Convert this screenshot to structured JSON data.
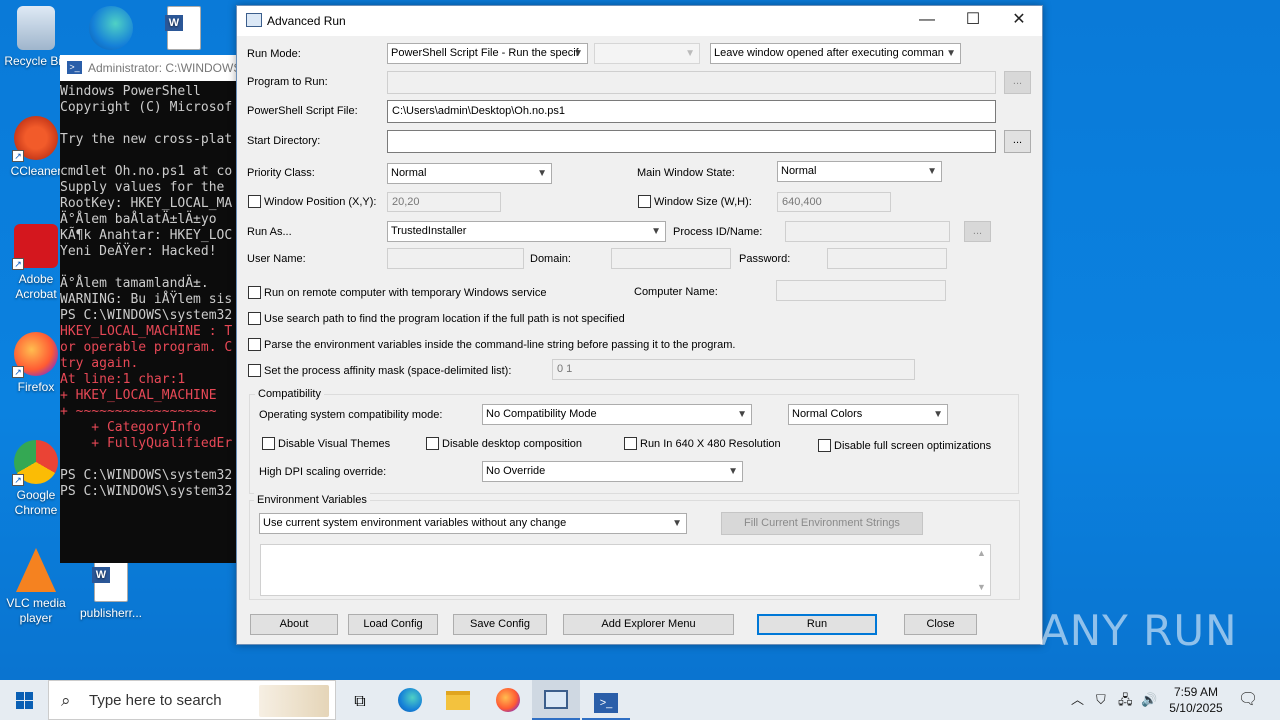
{
  "desktop": {
    "icons": [
      {
        "label": "Recycle Bin"
      },
      {
        "label": "CCleaner"
      },
      {
        "label": "Adobe Acrobat"
      },
      {
        "label": "Firefox"
      },
      {
        "label": "Google Chrome"
      },
      {
        "label": "VLC media player"
      },
      {
        "label": "publisherr..."
      }
    ]
  },
  "powershell": {
    "title": "Administrator: C:\\WINDOWS",
    "lines": [
      "Windows PowerShell",
      "Copyright (C) Microsof",
      "",
      "Try the new cross-plat",
      "",
      "cmdlet Oh.no.ps1 at co",
      "Supply values for the",
      "RootKey: HKEY_LOCAL_MA",
      "Ä°Å­lem baÅ­latÄ±lÄ±yo",
      "KÃ¶k Anahtar: HKEY_LOC",
      "Yeni DeÄŸer: Hacked!",
      "",
      "Ä°Å­lem tamamlandÄ±.",
      "WARNING: Bu iÅŸlem sis",
      "PS C:\\WINDOWS\\system32"
    ],
    "error_lines": [
      "HKEY_LOCAL_MACHINE : T",
      "or operable program. C",
      "try again.",
      "At line:1 char:1",
      "+ HKEY_LOCAL_MACHINE",
      "+ ~~~~~~~~~~~~~~~~~~",
      "    + CategoryInfo",
      "    + FullyQualifiedEr"
    ],
    "tail_lines": [
      "",
      "PS C:\\WINDOWS\\system32",
      "PS C:\\WINDOWS\\system32"
    ]
  },
  "dialog": {
    "title": "Advanced Run",
    "controls": {
      "minimize": "—",
      "maximize": "☐",
      "close": "✕"
    },
    "run_mode_label": "Run Mode:",
    "run_mode_value": "PowerShell Script File - Run the specif",
    "run_mode_extra": "",
    "window_option": "Leave window opened after executing comman",
    "program_label": "Program to Run:",
    "program_value": "",
    "browse": "...",
    "script_label": "PowerShell Script File:",
    "script_value": "C:\\Users\\admin\\Desktop\\Oh.no.ps1",
    "start_dir_label": "Start Directory:",
    "start_dir_value": "",
    "priority_label": "Priority Class:",
    "priority_value": "Normal",
    "main_state_label": "Main Window State:",
    "main_state_value": "Normal",
    "win_pos_label": "Window Position (X,Y):",
    "win_pos_value": "20,20",
    "win_size_label": "Window Size (W,H):",
    "win_size_value": "640,400",
    "run_as_label": "Run As...",
    "run_as_value": "TrustedInstaller",
    "process_label": "Process ID/Name:",
    "user_label": "User Name:",
    "domain_label": "Domain:",
    "password_label": "Password:",
    "remote_label": "Run on remote computer with temporary Windows service",
    "computer_name_label": "Computer Name:",
    "search_path_label": "Use search path to find the program location if the full path is not specified",
    "parse_env_label": "Parse the environment variables inside the command-line string before passing it to the program.",
    "affinity_label": "Set the process affinity mask (space-delimited list):",
    "affinity_value": "0 1",
    "compat_group": "Compatibility",
    "os_compat_label": "Operating system compatibility mode:",
    "os_compat_value": "No Compatibility Mode",
    "colors_value": "Normal Colors",
    "disable_themes": "Disable Visual Themes",
    "disable_desktop_comp": "Disable desktop composition",
    "run_640": "Run In 640 X 480 Resolution",
    "disable_fullscreen": "Disable full screen optimizations",
    "dpi_label": "High DPI scaling override:",
    "dpi_value": "No Override",
    "env_group": "Environment Variables",
    "env_value": "Use current system environment variables without any change",
    "fill_env": "Fill Current Environment Strings",
    "buttons": {
      "about": "About",
      "load": "Load Config",
      "save": "Save Config",
      "explorer": "Add Explorer Menu",
      "run": "Run",
      "close": "Close"
    }
  },
  "taskbar": {
    "search_placeholder": "Type here to search",
    "time": "7:59 AM",
    "date": "5/10/2025"
  },
  "watermark": "ANY RUN"
}
